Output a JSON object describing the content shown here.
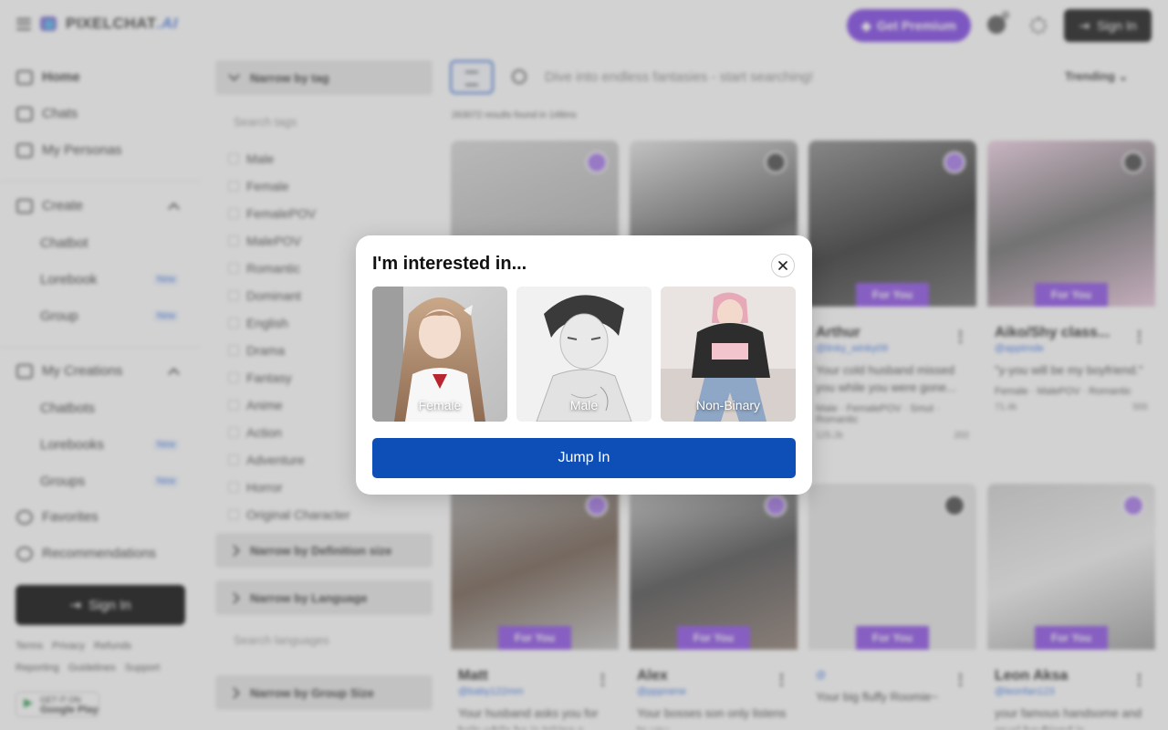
{
  "header": {
    "brand": "PIXELCHAT",
    "brand_suffix": ".AI",
    "premium_label": "Get Premium",
    "coin_badge": "0",
    "signin_label": "Sign In"
  },
  "sidebar": {
    "home": "Home",
    "chats": "Chats",
    "personas": "My Personas",
    "create": "Create",
    "chatbot": "Chatbot",
    "lorebook": "Lorebook",
    "group": "Group",
    "my_creations": "My Creations",
    "chatbots": "Chatbots",
    "lorebooks": "Lorebooks",
    "groups": "Groups",
    "favorites": "Favorites",
    "recommendations": "Recommendations",
    "new_badge": "New",
    "signin_label": "Sign In",
    "footer_row1": [
      "Terms",
      "Privacy",
      "Refunds"
    ],
    "footer_row2": [
      "Reporting",
      "Guidelines",
      "Support"
    ],
    "gplay_small": "GET IT ON",
    "gplay_big": "Google Play"
  },
  "filters": {
    "tag_header": "Narrow by tag",
    "tag_search_placeholder": "Search tags",
    "tags": [
      "Male",
      "Female",
      "FemalePOV",
      "MalePOV",
      "Romantic",
      "Dominant",
      "English",
      "Drama",
      "Fantasy",
      "Anime",
      "Action",
      "Adventure",
      "Horror",
      "Original Character"
    ],
    "definition_header": "Narrow by Definition size",
    "language_header": "Narrow by Language",
    "language_search_placeholder": "Search languages",
    "group_size_header": "Narrow by Group Size"
  },
  "search": {
    "placeholder": "Dive into endless fantasies - start searching!",
    "sort_label": "Trending",
    "results": "263072 results found in 148ms"
  },
  "cards": {
    "badge": "For You",
    "arthur": {
      "name": "Arthur",
      "handle": "@linky_winky09",
      "desc": "Your cold husband missed you while you were gone...",
      "tags": "Male · FemalePOV · Smut · Romantic",
      "stats_left": "125.2k",
      "stats_right": "202"
    },
    "aiko": {
      "name": "Aiko/Shy class...",
      "handle": "@apptmde",
      "desc": "\"y-you will be my boyfriend.\"",
      "tags": "Female · MalePOV · Romantic",
      "stats_left": "71.4k",
      "stats_right": "555"
    },
    "matt": {
      "name": "Matt",
      "handle": "@baby122mm",
      "desc": "Your husband asks you for help while he is taking a..."
    },
    "alex": {
      "name": "Alex",
      "handle": "@pppnene",
      "desc": "Your bosses son only listens to you..."
    },
    "fluffy": {
      "name": "",
      "handle": "@",
      "desc": "Your big fluffy Roomie~"
    },
    "leon": {
      "name": "Leon Aksa",
      "handle": "@leonfan123",
      "desc": "your famous handsome and cruel boyfriend is..."
    }
  },
  "modal": {
    "title": "I'm interested in...",
    "options": [
      "Female",
      "Male",
      "Non-Binary"
    ],
    "cta": "Jump In"
  }
}
